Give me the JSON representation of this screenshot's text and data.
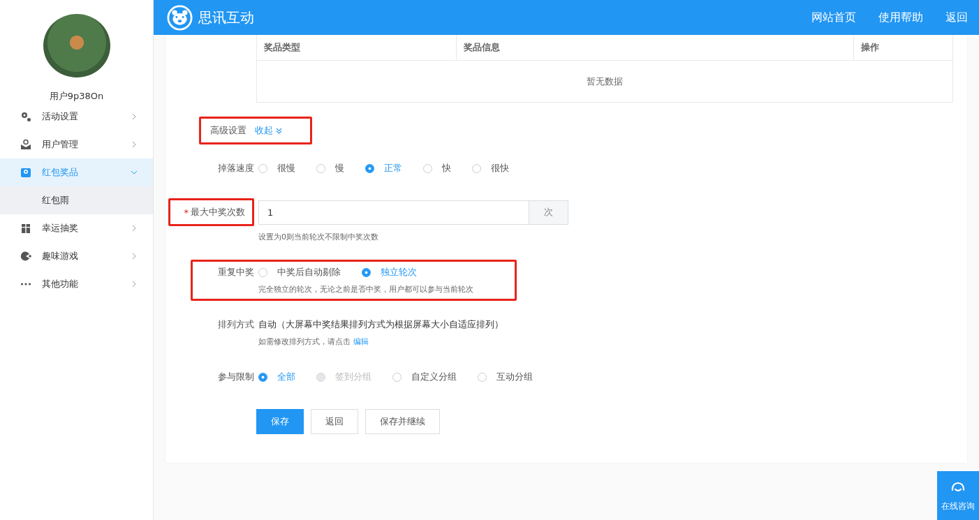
{
  "sidebar": {
    "username": "用户9p38On",
    "menu": [
      {
        "label": "活动设置",
        "expanded": false,
        "selected": false
      },
      {
        "label": "用户管理",
        "expanded": false,
        "selected": false
      },
      {
        "label": "红包奖品",
        "expanded": true,
        "selected": true,
        "children": [
          {
            "label": "红包雨",
            "selected": true
          }
        ]
      },
      {
        "label": "幸运抽奖",
        "expanded": false,
        "selected": false
      },
      {
        "label": "趣味游戏",
        "expanded": false,
        "selected": false
      },
      {
        "label": "其他功能",
        "expanded": false,
        "selected": false
      }
    ]
  },
  "header": {
    "brand": "思讯互动",
    "links": [
      "网站首页",
      "使用帮助",
      "返回"
    ]
  },
  "prize_table": {
    "columns": [
      "奖品类型",
      "奖品信息",
      "操作"
    ],
    "empty_text": "暂无数据"
  },
  "form": [
    {
      "kind": "toggle",
      "label": "高级设置",
      "highlighted": true,
      "link": "收起"
    },
    {
      "kind": "radio",
      "label": "掉落速度",
      "highlighted": false,
      "options": [
        {
          "label": "很慢",
          "selected": false,
          "disabled": false
        },
        {
          "label": "慢",
          "selected": false,
          "disabled": false
        },
        {
          "label": "正常",
          "selected": true,
          "disabled": false
        },
        {
          "label": "快",
          "selected": false,
          "disabled": false
        },
        {
          "label": "很快",
          "selected": false,
          "disabled": false
        }
      ]
    },
    {
      "kind": "input",
      "label": "最大中奖次数",
      "required_mark": "*",
      "highlighted": true,
      "value": "1",
      "suffix": "次",
      "hint": "设置为0则当前轮次不限制中奖次数"
    },
    {
      "kind": "radio",
      "label": "重复中奖",
      "highlighted": true,
      "options": [
        {
          "label": "中奖后自动剔除",
          "selected": false,
          "disabled": false
        },
        {
          "label": "独立轮次",
          "selected": true,
          "disabled": false
        }
      ],
      "hint": "完全独立的轮次，无论之前是否中奖，用户都可以参与当前轮次"
    },
    {
      "kind": "text",
      "label": "排列方式",
      "highlighted": false,
      "value": "自动（大屏幕中奖结果排列方式为根据屏幕大小自适应排列）",
      "hint": "如需修改排列方式，请点击",
      "hint_link": "编辑"
    },
    {
      "kind": "radio",
      "label": "参与限制",
      "highlighted": false,
      "options": [
        {
          "label": "全部",
          "selected": true,
          "disabled": false
        },
        {
          "label": "签到分组",
          "selected": false,
          "disabled": true
        },
        {
          "label": "自定义分组",
          "selected": false,
          "disabled": false
        },
        {
          "label": "互动分组",
          "selected": false,
          "disabled": false
        }
      ]
    }
  ],
  "buttons": [
    {
      "label": "保存",
      "primary": true
    },
    {
      "label": "返回",
      "primary": false
    },
    {
      "label": "保存并继续",
      "primary": false
    }
  ],
  "support": {
    "label": "在线咨询"
  }
}
